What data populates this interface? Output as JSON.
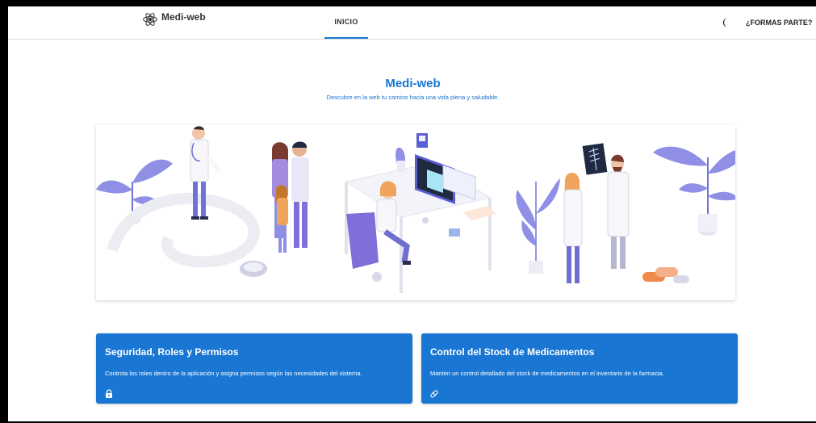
{
  "navbar": {
    "brand_name": "Medi-web",
    "tab_label": "INICIO",
    "join_label": "¿FORMAS PARTE?"
  },
  "hero": {
    "title": "Medi-web",
    "subtitle": "Descubre en la web tu camino hacia una vida plena y saludable."
  },
  "cards": [
    {
      "title": "Seguridad, Roles y Permisos",
      "description": "Controla los roles dentro de la aplicación y asigna permisos según las necesidades del sistema.",
      "icon": "lock-icon"
    },
    {
      "title": "Control del Stock de Medicamentos",
      "description": "Mantén un control detallado del stock de medicamentos en el inventario de la farmacia.",
      "icon": "pill-icon"
    }
  ],
  "colors": {
    "primary": "#1976d2",
    "illustration_purple": "#8f8fe6"
  }
}
